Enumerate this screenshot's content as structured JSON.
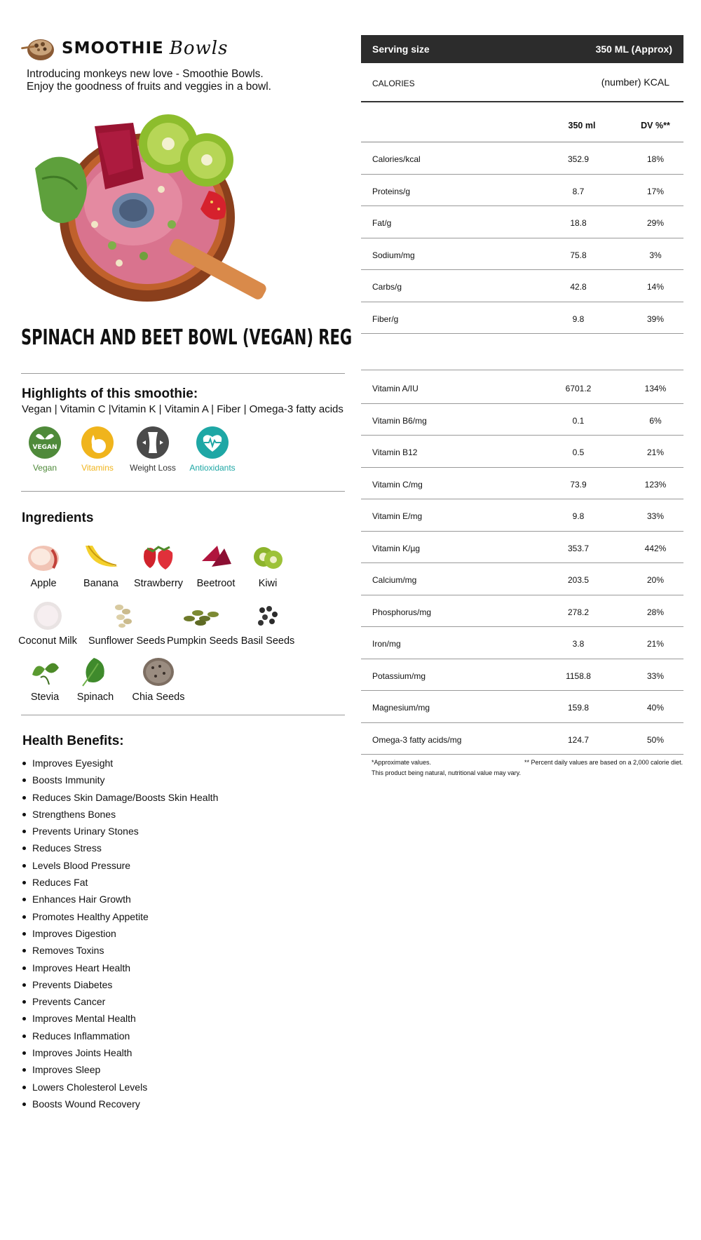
{
  "brand": {
    "name": "SMOOTHIE",
    "script": "Bowls"
  },
  "intro": {
    "line1": "Introducing monkeys new love - Smoothie Bowls.",
    "line2": "Enjoy the goodness of fruits and veggies in a bowl."
  },
  "product_title": "SPINACH AND BEET BOWL (VEGAN) REG",
  "highlights": {
    "heading": "Highlights of this smoothie:",
    "summary": "Vegan | Vitamin C |Vitamin K | Vitamin A | Fiber | Omega-3 fatty acids",
    "badges": [
      {
        "label": "Vegan",
        "icon": "vegan-leaf-icon",
        "color": "#4f8a3a"
      },
      {
        "label": "Vitamins",
        "icon": "fruit-icon",
        "color": "#f0b41c"
      },
      {
        "label": "Weight Loss",
        "icon": "body-icon",
        "color": "#4a4a4a"
      },
      {
        "label": "Antioxidants",
        "icon": "heartbeat-icon",
        "color": "#1ea7a5"
      }
    ]
  },
  "ingredients": {
    "heading": "Ingredients",
    "items": [
      "Apple",
      "Banana",
      "Strawberry",
      "Beetroot",
      "Kiwi",
      "Coconut Milk",
      "Sunflower Seeds",
      "Pumpkin Seeds",
      "Basil Seeds",
      "Stevia",
      "Spinach",
      "Chia Seeds"
    ]
  },
  "benefits": {
    "heading": "Health Benefits:",
    "items": [
      "Improves Eyesight",
      "Boosts Immunity",
      "Reduces Skin Damage/Boosts Skin Health",
      "Strengthens Bones",
      "Prevents Urinary Stones",
      "Reduces Stress",
      "Levels Blood Pressure",
      "Reduces Fat",
      "Enhances Hair Growth",
      "Promotes Healthy Appetite",
      "Improves Digestion",
      "Removes Toxins",
      "Improves Heart Health",
      "Prevents Diabetes",
      "Prevents Cancer",
      "Improves Mental Health",
      "Reduces Inflammation",
      "Improves Joints Health",
      "Improves Sleep",
      "Lowers Cholesterol Levels",
      "Boosts Wound Recovery"
    ]
  },
  "nutrition": {
    "serving_label": "Serving size",
    "serving_value": "350 ML (Approx)",
    "calories_label": "CALORIES",
    "calories_value": "(number) KCAL",
    "col_amount": "350 ml",
    "col_dv": "DV %**",
    "rows_main": [
      {
        "name": "Calories/kcal",
        "value": "352.9",
        "dv": "18%"
      },
      {
        "name": "Proteins/g",
        "value": "8.7",
        "dv": "17%"
      },
      {
        "name": "Fat/g",
        "value": "18.8",
        "dv": "29%"
      },
      {
        "name": "Sodium/mg",
        "value": "75.8",
        "dv": "3%"
      },
      {
        "name": "Carbs/g",
        "value": "42.8",
        "dv": "14%"
      },
      {
        "name": "Fiber/g",
        "value": "9.8",
        "dv": "39%"
      }
    ],
    "rows_micro": [
      {
        "name": "Vitamin A/IU",
        "value": "6701.2",
        "dv": "134%"
      },
      {
        "name": "Vitamin B6/mg",
        "value": "0.1",
        "dv": "6%"
      },
      {
        "name": "Vitamin B12",
        "value": "0.5",
        "dv": "21%"
      },
      {
        "name": "Vitamin C/mg",
        "value": "73.9",
        "dv": "123%"
      },
      {
        "name": "Vitamin E/mg",
        "value": "9.8",
        "dv": "33%"
      },
      {
        "name": "Vitamin K/µg",
        "value": "353.7",
        "dv": "442%"
      },
      {
        "name": "Calcium/mg",
        "value": "203.5",
        "dv": "20%"
      },
      {
        "name": "Phosphorus/mg",
        "value": "278.2",
        "dv": "28%"
      },
      {
        "name": "Iron/mg",
        "value": "3.8",
        "dv": "21%"
      },
      {
        "name": "Potassium/mg",
        "value": "1158.8",
        "dv": "33%"
      },
      {
        "name": "Magnesium/mg",
        "value": "159.8",
        "dv": "40%"
      },
      {
        "name": "Omega-3 fatty acids/mg",
        "value": "124.7",
        "dv": "50%"
      }
    ],
    "footnote_left_1": "*Approximate values.",
    "footnote_left_2": "This product being natural, nutritional value may vary.",
    "footnote_right": "** Percent daily values are based on a 2,000 calorie diet."
  }
}
